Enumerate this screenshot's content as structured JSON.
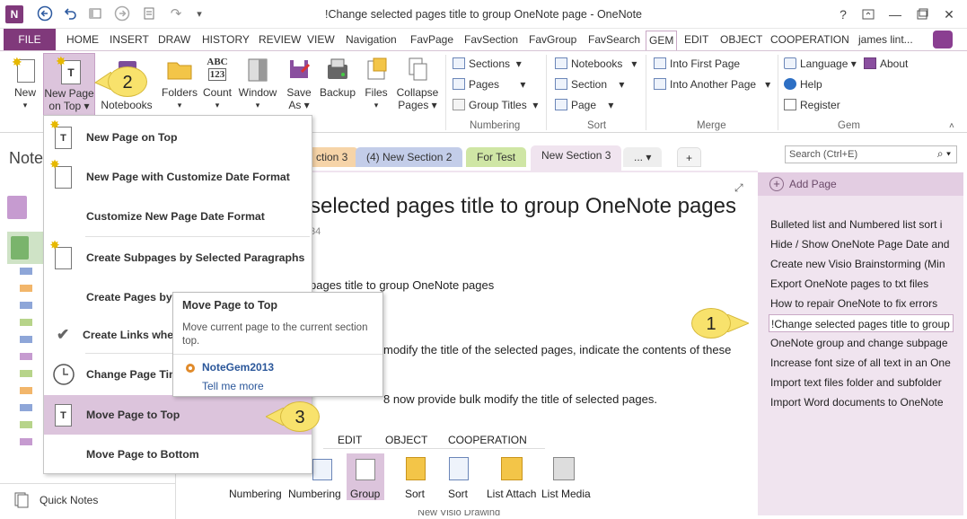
{
  "window": {
    "title": "!Change selected pages title to group OneNote page - OneNote",
    "help": "?"
  },
  "quick_access": [
    "back-icon",
    "undo-icon",
    "dock-icon",
    "forward-icon",
    "page-icon",
    "redo-icon",
    "more-icon"
  ],
  "tabs": [
    "FILE",
    "HOME",
    "INSERT",
    "DRAW",
    "HISTORY",
    "REVIEW",
    "VIEW",
    "Navigation",
    "FavPage",
    "FavSection",
    "FavGroup",
    "FavSearch",
    "GEM",
    "EDIT",
    "OBJECT",
    "COOPERATION"
  ],
  "user": "james lint...",
  "ribbon": {
    "new": "New",
    "new_page_on_top": [
      "New Page",
      "on Top"
    ],
    "notebooks": "Notebooks",
    "folders": "Folders",
    "count": "Count",
    "window": "Window",
    "save_as": [
      "Save",
      "As"
    ],
    "backup": "Backup",
    "files": "Files",
    "collapse_pages": [
      "Collapse",
      "Pages"
    ],
    "sections": "Sections",
    "pages": "Pages",
    "group_titles": "Group Titles",
    "numbering_label": "Numbering",
    "notebooks_sort": "Notebooks",
    "section_sort": "Section",
    "page_sort": "Page",
    "sort_label": "Sort",
    "into_first_page": "Into First Page",
    "into_another_page": "Into Another Page",
    "merge_label": "Merge",
    "language": "Language",
    "about": "About",
    "help": "Help",
    "register": "Register",
    "gem_label": "Gem"
  },
  "left": {
    "notebooks_heading": "Note",
    "quick_notes": "Quick Notes"
  },
  "section_tabs": [
    "ction 3",
    "(4) New Section 2",
    "For Test",
    "New Section 3",
    "..."
  ],
  "search": {
    "placeholder": "Search (Ctrl+E)"
  },
  "pages_pane": {
    "add_page": "Add Page",
    "pages": [
      "Bulleted list and Numbered list sort i",
      "Hide / Show OneNote Page Date and",
      "Create new Visio Brainstorming (Min",
      "Export OneNote pages to txt files",
      "How to repair OneNote to fix errors",
      "!Change selected pages title to group",
      "OneNote group and change subpage",
      "Increase font size of all text in an One",
      "Import text files folder and subfolder",
      "Import Word documents to OneNote"
    ]
  },
  "content": {
    "title": "selected pages title to group OneNote pages",
    "date": "34",
    "line1": "pages title to group OneNote pages",
    "line2": "modify the title of the selected pages, indicate the contents of these",
    "line3": "8 now provide bulk modify the title of selected pages.",
    "inner_tabs": [
      "EDIT",
      "OBJECT",
      "COOPERATION"
    ],
    "inner_buttons": [
      "Numbering",
      "Numbering",
      "Group",
      "Sort",
      "Sort",
      "List Attach",
      "List Media"
    ],
    "bottom_text": "New Visio Drawing"
  },
  "dropdown": [
    "New Page on Top",
    "New Page with Customize Date Format",
    "Customize New Page Date Format",
    "Create Subpages by Selected Paragraphs",
    "Create Pages by S",
    "Create Links when",
    "Change Page Tim",
    "Move Page to Top",
    "Move Page to Bottom"
  ],
  "tooltip": {
    "title": "Move Page to Top",
    "desc": "Move current page to the current section top.",
    "addin": "NoteGem2013",
    "tell_more": "Tell me more"
  },
  "callouts": [
    "1",
    "2",
    "3"
  ],
  "colors": {
    "accent": "#80397b",
    "page_pane": "#f0e4ef",
    "highlight": "#dcc4dc",
    "callout": "#f8e26c"
  }
}
